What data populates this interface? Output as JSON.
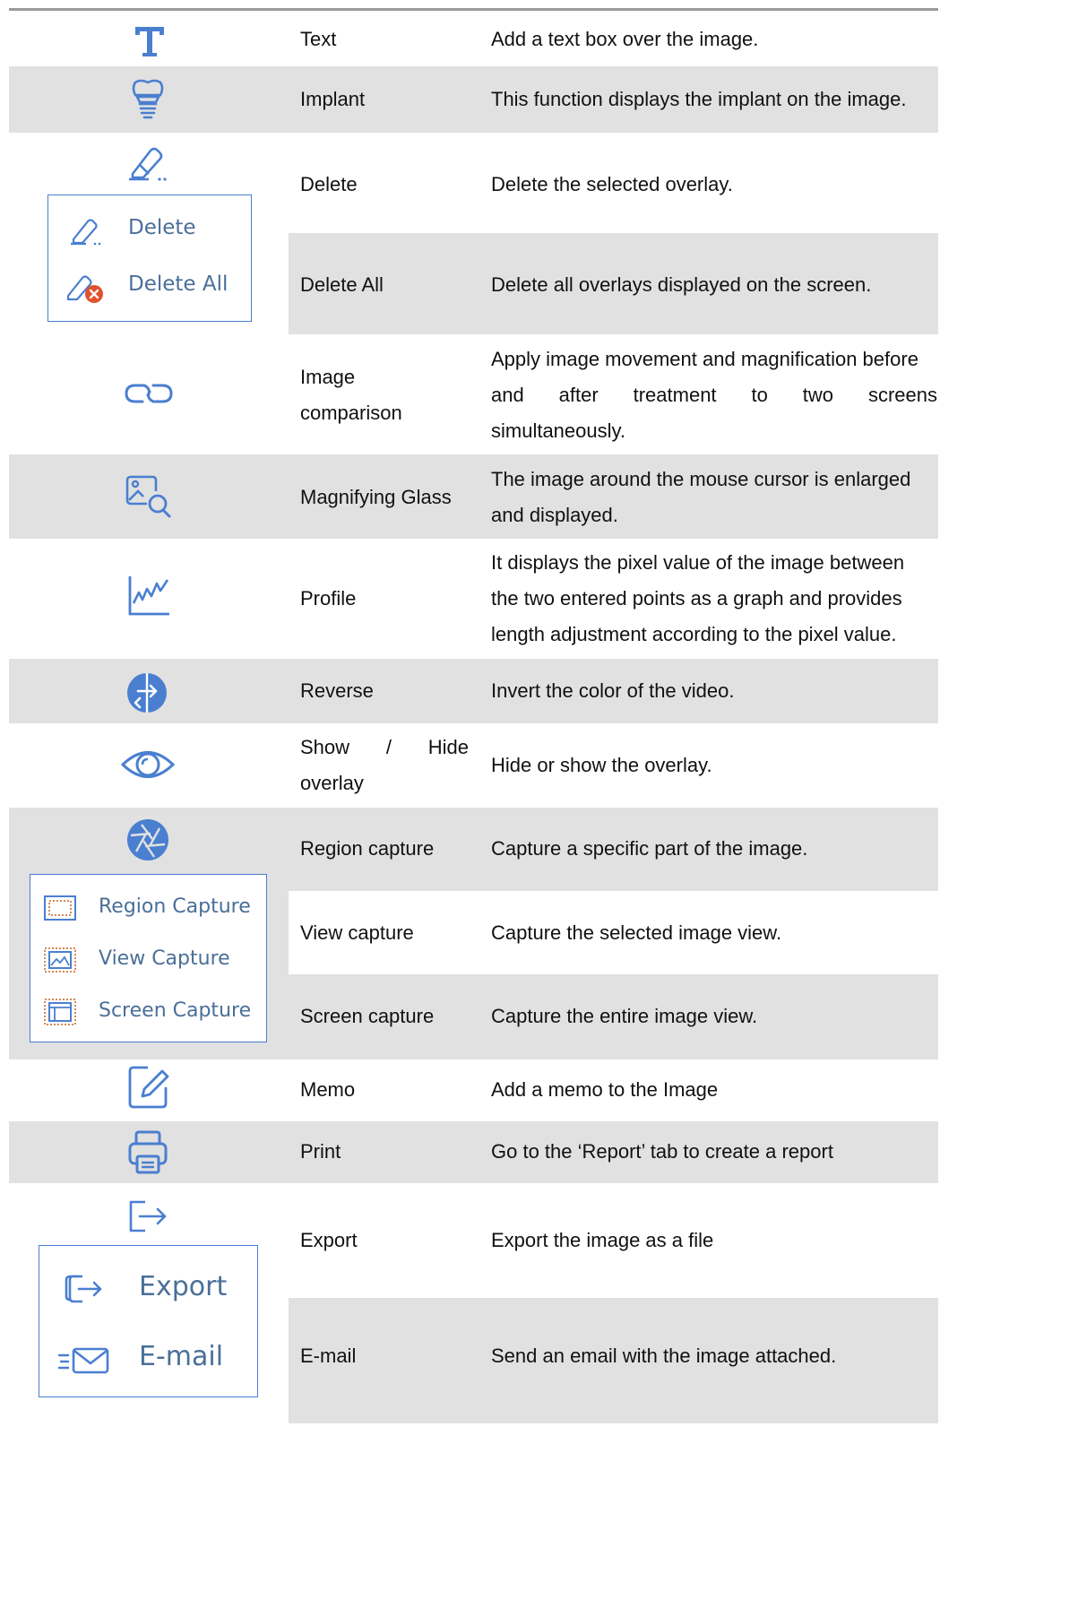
{
  "rows": [
    {
      "name": "Text",
      "desc": "Add a text box over the image.",
      "icon": "text-tool-icon"
    },
    {
      "name": "Implant",
      "desc": "This function displays the implant on the image.",
      "icon": "implant-icon"
    },
    {
      "name": "Delete",
      "desc": "Delete the selected overlay.",
      "icon": "eraser-icon"
    },
    {
      "name": "Delete All",
      "desc": "Delete all overlays displayed on the screen."
    },
    {
      "name_lines": [
        "Image",
        "comparison"
      ],
      "desc_lines": [
        "Apply image movement and magnification before",
        "and after treatment to two screens",
        "simultaneously."
      ],
      "icon": "link-icon"
    },
    {
      "name": "Magnifying Glass",
      "desc_lines": [
        "The image around the mouse cursor is enlarged",
        "and displayed."
      ],
      "icon": "magnifier-image-icon"
    },
    {
      "name": "Profile",
      "desc_lines": [
        "It displays the pixel value of the image between",
        "the two entered points as a graph and provides",
        "length adjustment according to the pixel value."
      ],
      "icon": "profile-graph-icon"
    },
    {
      "name": "Reverse",
      "desc": "Invert the color of the video.",
      "icon": "reverse-icon"
    },
    {
      "name_lines": [
        "Show / Hide",
        "overlay"
      ],
      "desc": "Hide or show the overlay.",
      "icon": "eye-icon"
    },
    {
      "name": "Region capture",
      "desc": "Capture a specific part of the image.",
      "icon": "camera-shutter-icon"
    },
    {
      "name": "View capture",
      "desc": "Capture the selected image view."
    },
    {
      "name": "Screen capture",
      "desc": "Capture the entire image view."
    },
    {
      "name": "Memo",
      "desc": "Add a memo to the Image",
      "icon": "memo-edit-icon"
    },
    {
      "name": "Print",
      "desc": "Go to the ‘Report’ tab to create a report",
      "icon": "printer-icon"
    },
    {
      "name": "Export",
      "desc": "Export the image as a file",
      "icon": "export-icon"
    },
    {
      "name": "E-mail",
      "desc": "Send an email with the image attached."
    }
  ],
  "popups": {
    "delete": [
      "Delete",
      "Delete All"
    ],
    "capture": [
      "Region Capture",
      "View Capture",
      "Screen Capture"
    ],
    "export": [
      "Export",
      "E-mail"
    ]
  },
  "colors": {
    "row_grey": "#e1e1e1",
    "icon_blue": "#4a7fd0",
    "popup_text": "#4a6f98",
    "delete_all_badge": "#e0522e"
  }
}
